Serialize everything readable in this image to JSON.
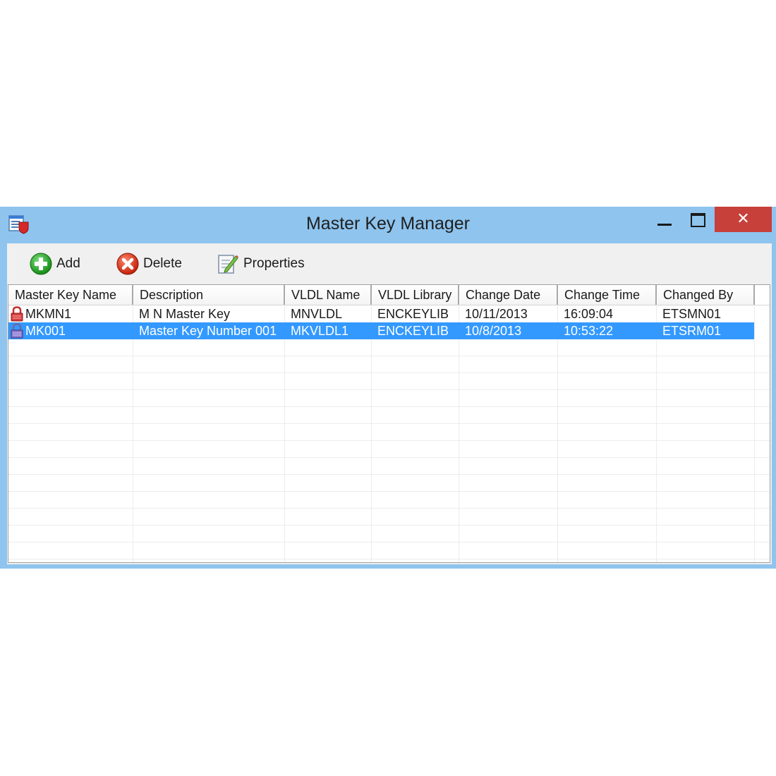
{
  "window": {
    "title": "Master Key Manager"
  },
  "titlebar": {
    "close_glyph": "✕"
  },
  "toolbar": {
    "add_label": "Add",
    "delete_label": "Delete",
    "properties_label": "Properties"
  },
  "table": {
    "columns": [
      "Master Key Name",
      "Description",
      "VLDL Name",
      "VLDL Library",
      "Change Date",
      "Change Time",
      "Changed By"
    ],
    "rows": [
      {
        "icon": "lock-icon",
        "cells": [
          "MKMN1",
          "M N Master Key",
          "MNVLDL",
          "ENCKEYLIB",
          "10/11/2013",
          "16:09:04",
          "ETSMN01"
        ],
        "selected": false
      },
      {
        "icon": "lock-icon",
        "cells": [
          "MK001",
          "Master Key Number 001",
          "MKVLDL1",
          "ENCKEYLIB",
          "10/8/2013",
          "10:53:22",
          "ETSRM01"
        ],
        "selected": true
      }
    ]
  },
  "colors": {
    "title_bar": "#8ec4ee",
    "close": "#c7403a",
    "selection": "#3399ff"
  }
}
